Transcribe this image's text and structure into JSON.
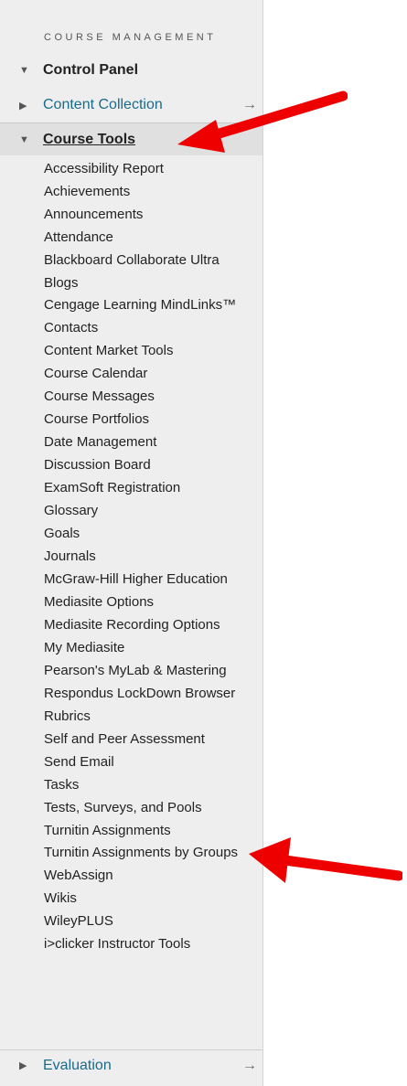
{
  "section_heading": "COURSE MANAGEMENT",
  "nav": {
    "control_panel": "Control Panel",
    "content_collection": "Content Collection",
    "course_tools": "Course Tools",
    "evaluation": "Evaluation"
  },
  "icons": {
    "expanded": "triangle-down-icon",
    "collapsed": "triangle-right-icon",
    "go": "right-arrow-icon",
    "callout": "red-arrow-icon"
  },
  "glyphs": {
    "down": "▼",
    "right": "▶",
    "arrow": "→"
  },
  "colors": {
    "link": "#1a6a8a",
    "callout": "#ee0000",
    "panel": "#eeeeee"
  },
  "course_tools_items": [
    "Accessibility Report",
    "Achievements",
    "Announcements",
    "Attendance",
    "Blackboard Collaborate Ultra",
    "Blogs",
    "Cengage Learning MindLinks™",
    "Contacts",
    "Content Market Tools",
    "Course Calendar",
    "Course Messages",
    "Course Portfolios",
    "Date Management",
    "Discussion Board",
    "ExamSoft Registration",
    "Glossary",
    "Goals",
    "Journals",
    "McGraw-Hill Higher Education",
    "Mediasite Options",
    "Mediasite Recording Options",
    "My Mediasite",
    "Pearson's MyLab & Mastering",
    "Respondus LockDown Browser",
    "Rubrics",
    "Self and Peer Assessment",
    "Send Email",
    "Tasks",
    "Tests, Surveys, and Pools",
    "Turnitin Assignments",
    "Turnitin Assignments by Groups",
    "WebAssign",
    "Wikis",
    "WileyPLUS",
    "i>clicker Instructor Tools"
  ]
}
